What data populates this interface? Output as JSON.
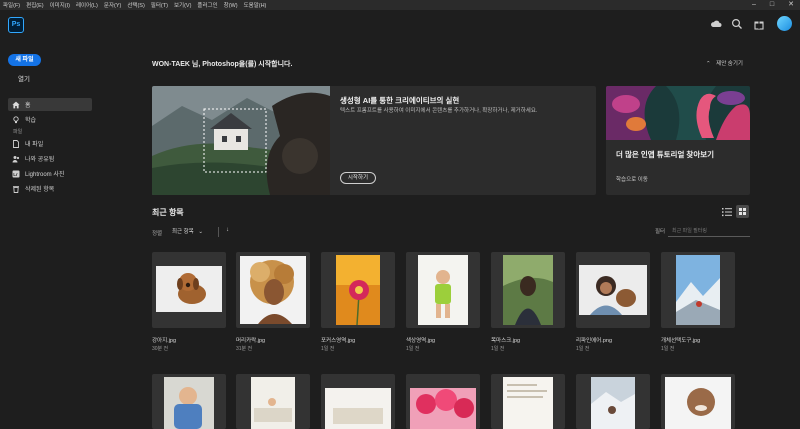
{
  "menubar": {
    "items": [
      "파일(F)",
      "편집(E)",
      "이미지(I)",
      "레이어(L)",
      "문자(Y)",
      "선택(S)",
      "필터(T)",
      "보기(V)",
      "플러그인",
      "창(W)",
      "도움말(H)"
    ]
  },
  "appbar": {
    "logo": "Ps"
  },
  "sidebar": {
    "new_file": "새 파일",
    "open": "열기",
    "files_label": "파일",
    "nav": [
      {
        "label": "홈",
        "icon": "home-icon"
      },
      {
        "label": "학습",
        "icon": "lightbulb-icon"
      },
      {
        "label": "내 파일",
        "icon": "file-icon"
      },
      {
        "label": "나와 공유됨",
        "icon": "shared-people-icon"
      },
      {
        "label": "Lightroom 사진",
        "icon": "lightroom-icon"
      },
      {
        "label": "삭제된 항목",
        "icon": "trash-icon"
      }
    ]
  },
  "main": {
    "greeting": "WON-TAEK 님, Photoshop을(를) 시작합니다.",
    "hide_suggestions": "제안 숨기기",
    "hero": {
      "title": "생성형 AI를 통한 크리에이티브의 실현",
      "description": "텍스트 프롬프트를 사용하여 이미지에서 콘텐츠를 추가하거나, 확장하거나, 제거하세요.",
      "button": "시작하기"
    },
    "tutorial": {
      "title": "더 많은 인앱 튜토리얼 찾아보기",
      "link": "학습으로 이동"
    },
    "recent": {
      "title": "최근 항목",
      "sort_label": "정렬",
      "sort_value": "최근 항목",
      "sort_dir_icon": "arrow-down-icon",
      "filter_label": "필터",
      "filter_placeholder": "최근 파일 필터링"
    },
    "files": [
      {
        "name": "강아지.jpg",
        "time": "30분 전"
      },
      {
        "name": "머리카락.jpg",
        "time": "31분 전"
      },
      {
        "name": "포커스영역.jpg",
        "time": "1일 전"
      },
      {
        "name": "색상영역.jpg",
        "time": "1일 전"
      },
      {
        "name": "목마스크.jpg",
        "time": "1일 전"
      },
      {
        "name": "리파인에어.png",
        "time": "1일 전"
      },
      {
        "name": "개체선택도구.jpg",
        "time": "1일 전"
      }
    ]
  }
}
